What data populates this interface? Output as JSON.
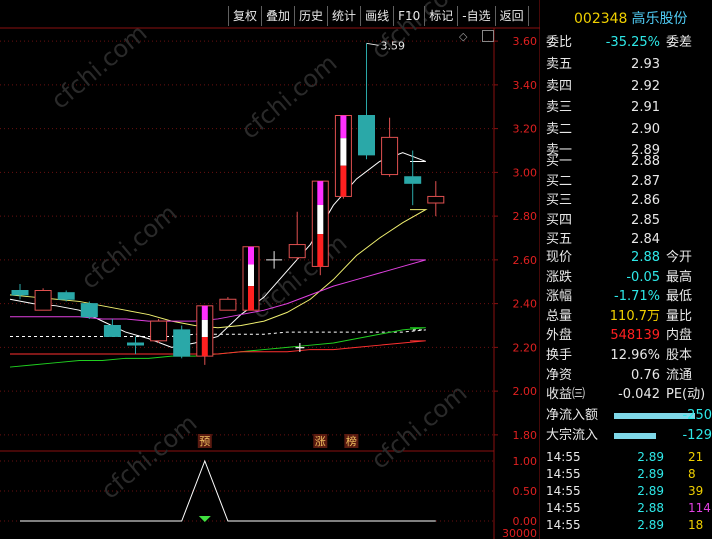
{
  "toolbar": {
    "items": [
      "复权",
      "叠加",
      "历史",
      "统计",
      "画线",
      "F10",
      "标记",
      "-自选",
      "返回"
    ]
  },
  "stock": {
    "code": "002348",
    "name": "高乐股份"
  },
  "order_book": {
    "weibi_label": "委比",
    "weibi_value": "-35.25%",
    "weicha_label": "委差",
    "asks": [
      {
        "label": "卖五",
        "price": "2.93"
      },
      {
        "label": "卖四",
        "price": "2.92"
      },
      {
        "label": "卖三",
        "price": "2.91"
      },
      {
        "label": "卖二",
        "price": "2.90"
      },
      {
        "label": "卖一",
        "price": "2.89"
      }
    ],
    "bids": [
      {
        "label": "买一",
        "price": "2.88"
      },
      {
        "label": "买二",
        "price": "2.87"
      },
      {
        "label": "买三",
        "price": "2.86"
      },
      {
        "label": "买四",
        "price": "2.85"
      },
      {
        "label": "买五",
        "price": "2.84"
      }
    ]
  },
  "quote": {
    "rows": [
      {
        "label": "现价",
        "value": "2.88",
        "label2": "今开",
        "color": "#2ee8e8"
      },
      {
        "label": "涨跌",
        "value": "-0.05",
        "label2": "最高",
        "color": "#2ee8e8"
      },
      {
        "label": "涨幅",
        "value": "-1.71%",
        "label2": "最低",
        "color": "#2ee8e8"
      },
      {
        "label": "总量",
        "value": "110.7万",
        "label2": "量比",
        "color": "#f0d000"
      },
      {
        "label": "外盘",
        "value": "548139",
        "label2": "内盘",
        "color": "#ff2020"
      },
      {
        "label": "换手",
        "value": "12.96%",
        "label2": "股本",
        "color": "#e8e8e8"
      },
      {
        "label": "净资",
        "value": "0.76",
        "label2": "流通",
        "color": "#e8e8e8"
      },
      {
        "label": "收益㈢",
        "value": "-0.042",
        "label2": "PE(动)",
        "color": "#e8e8e8"
      }
    ]
  },
  "flows": [
    {
      "label": "净流入额",
      "value": "-250",
      "fill": 0.62
    },
    {
      "label": "大宗流入",
      "value": "-129",
      "fill": 0.32
    }
  ],
  "trades": [
    {
      "time": "14:55",
      "price": "2.89",
      "vol": "21",
      "pcolor": "#2ee8e8",
      "vcolor": "#f0d000"
    },
    {
      "time": "14:55",
      "price": "2.89",
      "vol": "8",
      "pcolor": "#2ee8e8",
      "vcolor": "#f0d000"
    },
    {
      "time": "14:55",
      "price": "2.89",
      "vol": "39",
      "pcolor": "#2ee8e8",
      "vcolor": "#f0d000"
    },
    {
      "time": "14:55",
      "price": "2.88",
      "vol": "114",
      "pcolor": "#2ee8e8",
      "vcolor": "#e040e0"
    },
    {
      "time": "14:55",
      "price": "2.89",
      "vol": "18",
      "pcolor": "#2ee8e8",
      "vcolor": "#f0d000"
    }
  ],
  "watermark": "cfchi.com",
  "chart_data": {
    "type": "candlestick",
    "price_axis": {
      "ticks": [
        "3.60",
        "3.40",
        "3.20",
        "3.00",
        "2.80",
        "2.60",
        "2.40",
        "2.20",
        "2.00",
        "1.80"
      ],
      "ylim": [
        1.74,
        3.66
      ]
    },
    "high_annotation": "3.59",
    "candles": [
      {
        "o": 2.44,
        "h": 2.49,
        "l": 2.42,
        "c": 2.46,
        "color": "teal"
      },
      {
        "o": 2.37,
        "h": 2.47,
        "l": 2.37,
        "c": 2.46,
        "color": "red"
      },
      {
        "o": 2.45,
        "h": 2.46,
        "l": 2.41,
        "c": 2.42,
        "color": "teal"
      },
      {
        "o": 2.4,
        "h": 2.41,
        "l": 2.33,
        "c": 2.34,
        "color": "teal"
      },
      {
        "o": 2.3,
        "h": 2.33,
        "l": 2.25,
        "c": 2.25,
        "color": "teal"
      },
      {
        "o": 2.22,
        "h": 2.25,
        "l": 2.17,
        "c": 2.22,
        "color": "teal"
      },
      {
        "o": 2.23,
        "h": 2.33,
        "l": 2.22,
        "c": 2.32,
        "color": "red"
      },
      {
        "o": 2.28,
        "h": 2.3,
        "l": 2.15,
        "c": 2.16,
        "color": "teal"
      },
      {
        "o": 2.16,
        "h": 2.39,
        "l": 2.12,
        "c": 2.39,
        "color": "limit-up"
      },
      {
        "o": 2.37,
        "h": 2.43,
        "l": 2.37,
        "c": 2.42,
        "color": "red"
      },
      {
        "o": 2.37,
        "h": 2.66,
        "l": 2.37,
        "c": 2.66,
        "color": "limit-up"
      },
      {
        "o": 2.6,
        "h": 2.64,
        "l": 2.56,
        "c": 2.6,
        "color": "doji"
      },
      {
        "o": 2.61,
        "h": 2.82,
        "l": 2.6,
        "c": 2.67,
        "color": "red"
      },
      {
        "o": 2.57,
        "h": 2.96,
        "l": 2.53,
        "c": 2.96,
        "color": "limit-up"
      },
      {
        "o": 2.89,
        "h": 3.26,
        "l": 2.88,
        "c": 3.26,
        "color": "limit-up"
      },
      {
        "o": 3.26,
        "h": 3.59,
        "l": 3.06,
        "c": 3.08,
        "color": "teal"
      },
      {
        "o": 2.99,
        "h": 3.25,
        "l": 2.98,
        "c": 3.16,
        "color": "red"
      },
      {
        "o": 2.98,
        "h": 3.1,
        "l": 2.85,
        "c": 2.95,
        "color": "teal"
      },
      {
        "o": 2.86,
        "h": 2.96,
        "l": 2.8,
        "c": 2.89,
        "color": "red"
      }
    ],
    "ma": [
      {
        "name": "MA5",
        "color": "#ffffff",
        "values": [
          2.42,
          2.4,
          2.39,
          2.37,
          2.32,
          2.27,
          2.24,
          2.2,
          2.22,
          2.25,
          2.35,
          2.43,
          2.55,
          2.67,
          2.85,
          2.97,
          3.05,
          3.09,
          3.05
        ]
      },
      {
        "name": "MA10",
        "color": "#f0f070",
        "values": [
          2.44,
          2.43,
          2.42,
          2.41,
          2.39,
          2.37,
          2.35,
          2.32,
          2.3,
          2.29,
          2.3,
          2.32,
          2.36,
          2.42,
          2.51,
          2.62,
          2.7,
          2.77,
          2.83
        ]
      },
      {
        "name": "MA20",
        "color": "#e040e0",
        "values": [
          2.34,
          2.34,
          2.34,
          2.34,
          2.33,
          2.33,
          2.32,
          2.32,
          2.32,
          2.33,
          2.35,
          2.37,
          2.4,
          2.44,
          2.48,
          2.51,
          2.54,
          2.57,
          2.6
        ]
      },
      {
        "name": "MA30",
        "color": "#ffffff",
        "dashed": true,
        "values": [
          2.25,
          2.25,
          2.25,
          2.25,
          2.25,
          2.25,
          2.25,
          2.25,
          2.26,
          2.26,
          2.26,
          2.26,
          2.27,
          2.27,
          2.27,
          2.27,
          2.27,
          2.27,
          2.28
        ]
      },
      {
        "name": "MA60",
        "color": "#20d020",
        "values": [
          2.11,
          2.12,
          2.13,
          2.14,
          2.14,
          2.15,
          2.15,
          2.16,
          2.16,
          2.17,
          2.18,
          2.19,
          2.2,
          2.21,
          2.22,
          2.24,
          2.26,
          2.28,
          2.29
        ]
      },
      {
        "name": "MA120",
        "color": "#ff3030",
        "values": [
          2.17,
          2.17,
          2.17,
          2.17,
          2.17,
          2.17,
          2.17,
          2.17,
          2.17,
          2.17,
          2.18,
          2.18,
          2.18,
          2.19,
          2.19,
          2.2,
          2.21,
          2.22,
          2.23
        ]
      }
    ],
    "markers": [
      {
        "index": 8,
        "text": "预"
      },
      {
        "index": 13,
        "text": "涨"
      },
      {
        "index": 14,
        "text": "榜"
      }
    ],
    "sub_axis": {
      "ticks": [
        "1.00",
        "0.50",
        "0.00"
      ],
      "bottom_label": "30000",
      "ylim": [
        0,
        1.1
      ]
    },
    "signal": [
      0,
      0,
      0,
      0,
      0,
      0,
      0,
      0,
      1,
      0,
      0,
      0,
      0,
      0,
      0,
      0,
      0,
      0,
      0
    ]
  }
}
